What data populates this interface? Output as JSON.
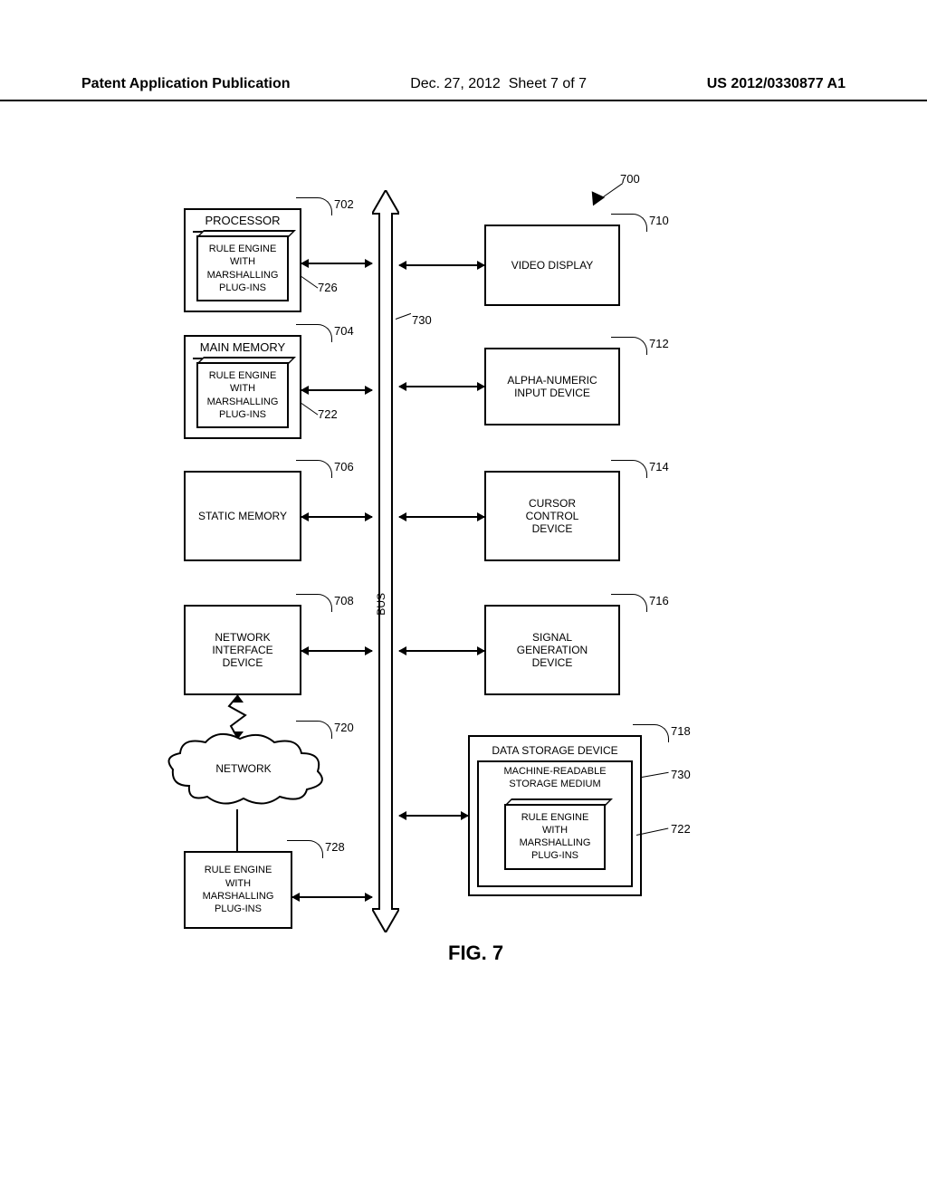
{
  "header": {
    "left": "Patent Application Publication",
    "date": "Dec. 27, 2012",
    "sheet": "Sheet 7 of 7",
    "pubnum": "US 2012/0330877 A1"
  },
  "figure_label": "FIG. 7",
  "bus_label": "BUS",
  "refs": {
    "r700": "700",
    "r702": "702",
    "r704": "704",
    "r706": "706",
    "r708": "708",
    "r710": "710",
    "r712": "712",
    "r714": "714",
    "r716": "716",
    "r718": "718",
    "r720": "720",
    "r722a": "722",
    "r722b": "722",
    "r726": "726",
    "r728": "728",
    "r730a": "730",
    "r730b": "730"
  },
  "blocks": {
    "processor_title": "PROCESSOR",
    "main_memory_title": "MAIN MEMORY",
    "static_memory": "STATIC MEMORY",
    "network_interface": "NETWORK\nINTERFACE\nDEVICE",
    "network_cloud": "NETWORK",
    "rule_engine": "RULE ENGINE\nWITH\nMARSHALLING\nPLUG-INS",
    "video_display": "VIDEO DISPLAY",
    "alpha_numeric": "ALPHA-NUMERIC\nINPUT DEVICE",
    "cursor_control": "CURSOR\nCONTROL\nDEVICE",
    "signal_gen": "SIGNAL\nGENERATION\nDEVICE",
    "data_storage_title": "DATA STORAGE DEVICE",
    "mrsm_title": "MACHINE-READABLE\nSTORAGE MEDIUM"
  }
}
